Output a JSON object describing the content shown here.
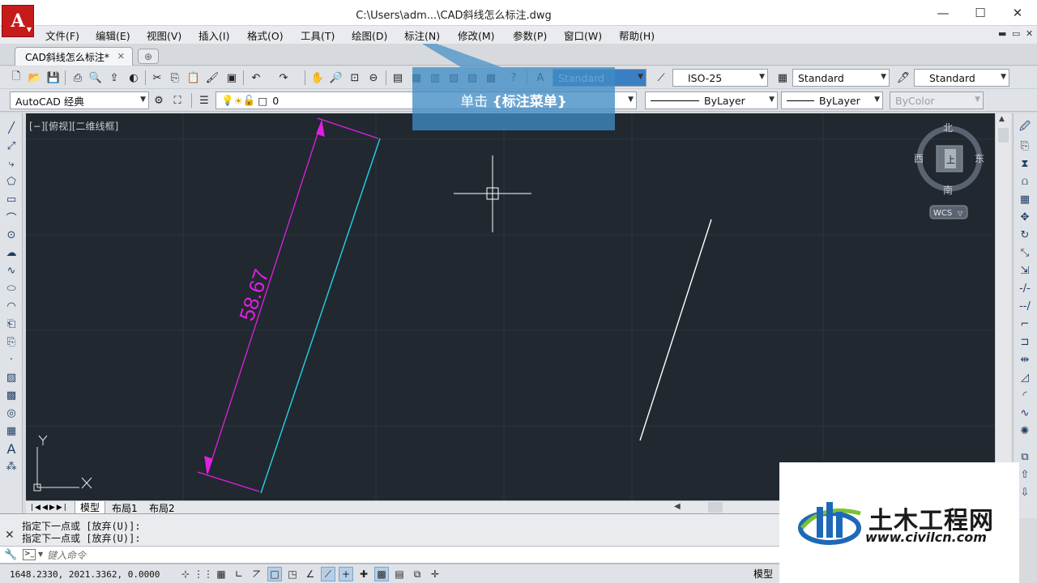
{
  "window": {
    "title": "C:\\Users\\adm...\\CAD斜线怎么标注.dwg",
    "app_logo": "A",
    "minimize": "—",
    "maximize": "☐",
    "close": "✕"
  },
  "menu": {
    "items": [
      "文件(F)",
      "编辑(E)",
      "视图(V)",
      "插入(I)",
      "格式(O)",
      "工具(T)",
      "绘图(D)",
      "标注(N)",
      "修改(M)",
      "参数(P)",
      "窗口(W)",
      "帮助(H)"
    ],
    "mdi_buttons": [
      "▬",
      "▭",
      "✕"
    ]
  },
  "tabs": {
    "doc_tab": "CAD斜线怎么标注*",
    "doc_tab_close": "✕"
  },
  "toolbar1": {
    "text_style": "Standard",
    "dim_style": "ISO-25",
    "table_style": "Standard",
    "multileader_style": "Standard"
  },
  "toolbar2": {
    "workspace": "AutoCAD 经典",
    "layer": "0",
    "linetype": "ByLayer",
    "lineweight": "ByLayer",
    "plotstyle": "ByColor"
  },
  "highlight": {
    "prefix": "单击",
    "target": "{标注菜单}"
  },
  "canvas": {
    "view_label": "[−][俯视][二维线框]",
    "dimension_text": "58.67",
    "compass": {
      "n": "北",
      "s": "南",
      "w": "西",
      "e": "东",
      "center": "上",
      "wcs": "WCS"
    },
    "ucs": {
      "y": "Y",
      "x": "X"
    },
    "colors": {
      "background": "#212830",
      "dimension": "#e020e0",
      "cyan_line": "#22d3e6",
      "white_line": "#ffffff"
    }
  },
  "layout_tabs": [
    "模型",
    "布局1",
    "布局2"
  ],
  "command": {
    "history": [
      "指定下一点或 [放弃(U)]:",
      "指定下一点或 [放弃(U)]:"
    ],
    "placeholder": "键入命令"
  },
  "status": {
    "coords": "1648.2330,  2021.3362,  0.0000",
    "model": "模型"
  },
  "watermark": {
    "name": "土木工程网",
    "url": "www.civilcn.com"
  }
}
